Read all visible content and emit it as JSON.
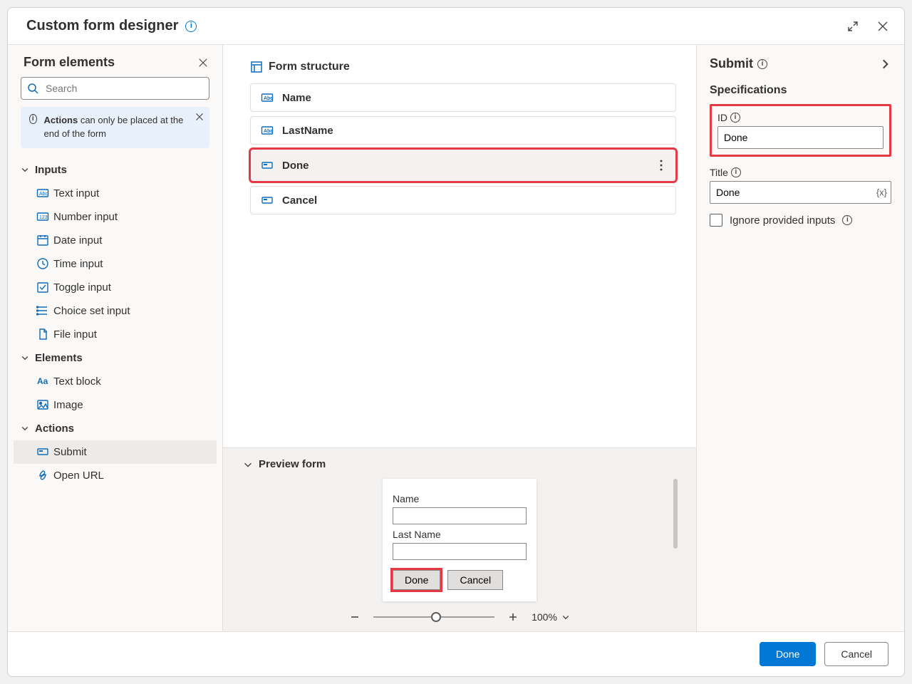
{
  "titlebar": {
    "title": "Custom form designer"
  },
  "sidebar": {
    "title": "Form elements",
    "search_placeholder": "Search",
    "note_prefix_bold": "Actions",
    "note_rest": " can only be placed at the end of the form",
    "groups": [
      {
        "label": "Inputs",
        "items": [
          {
            "label": "Text input",
            "icon": "text-input-icon"
          },
          {
            "label": "Number input",
            "icon": "number-input-icon"
          },
          {
            "label": "Date input",
            "icon": "date-input-icon"
          },
          {
            "label": "Time input",
            "icon": "time-input-icon"
          },
          {
            "label": "Toggle input",
            "icon": "toggle-input-icon"
          },
          {
            "label": "Choice set input",
            "icon": "choice-input-icon"
          },
          {
            "label": "File input",
            "icon": "file-input-icon"
          }
        ]
      },
      {
        "label": "Elements",
        "items": [
          {
            "label": "Text block",
            "icon": "text-block-icon"
          },
          {
            "label": "Image",
            "icon": "image-icon"
          }
        ]
      },
      {
        "label": "Actions",
        "selected_index": 0,
        "items": [
          {
            "label": "Submit",
            "icon": "submit-icon"
          },
          {
            "label": "Open URL",
            "icon": "open-url-icon"
          }
        ]
      }
    ]
  },
  "structure": {
    "title": "Form structure",
    "items": [
      {
        "label": "Name",
        "type": "text",
        "icon": "text-input-icon"
      },
      {
        "label": "LastName",
        "type": "text",
        "icon": "text-input-icon"
      },
      {
        "label": "Done",
        "type": "submit",
        "icon": "submit-icon",
        "selected": true
      },
      {
        "label": "Cancel",
        "type": "submit",
        "icon": "submit-icon"
      }
    ]
  },
  "preview": {
    "title": "Preview form",
    "fields": [
      {
        "label": "Name"
      },
      {
        "label": "Last Name"
      }
    ],
    "buttons": [
      {
        "label": "Done",
        "highlight": true
      },
      {
        "label": "Cancel",
        "highlight": false
      }
    ],
    "zoom_pct": "100%"
  },
  "inspector": {
    "title": "Submit",
    "section": "Specifications",
    "id_label": "ID",
    "id_value": "Done",
    "title_label": "Title",
    "title_value": "Done",
    "ignore_label": "Ignore provided inputs"
  },
  "footer": {
    "primary": "Done",
    "secondary": "Cancel"
  }
}
